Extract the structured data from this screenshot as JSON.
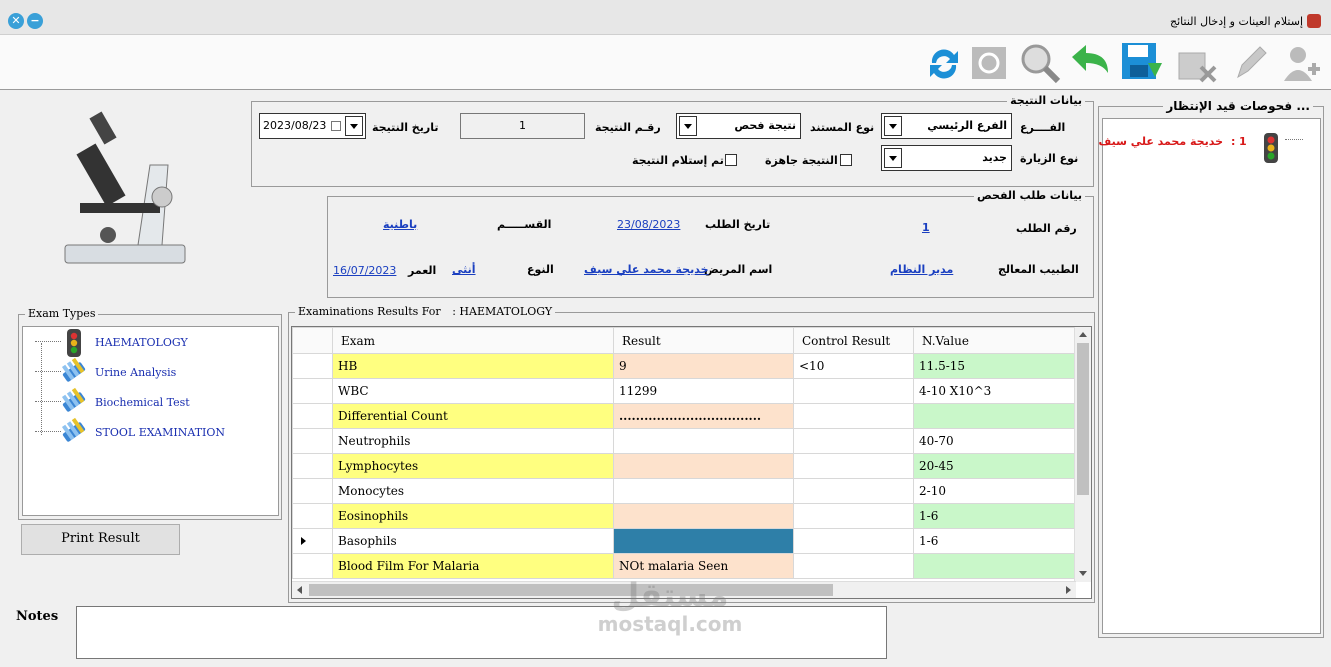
{
  "window": {
    "title": "إستلام العينات و إدخال النتائج",
    "controls": [
      "close",
      "minimize"
    ]
  },
  "toolbar": {
    "icons": [
      "add-user-icon",
      "edit-pencil-icon",
      "delete-icon",
      "save-icon",
      "undo-icon",
      "search-icon",
      "print-preview-icon",
      "refresh-icon"
    ]
  },
  "result_data": {
    "legend": "بيانات النتيجة",
    "branch_label": "الفــــرع",
    "branch_value": "الفرع الرئيسي",
    "doc_type_label": "نوع المستند",
    "doc_type_value": "نتيجة فحص",
    "result_no_label": "رقـم النتيجة",
    "result_no_value": "1",
    "result_date_label": "تاريخ النتيجة",
    "result_date_value": "2023/08/23",
    "visit_type_label": "نوع الزيارة",
    "visit_type_value": "جديد",
    "ready_label": "النتيجة جاهزة",
    "received_label": "تم إستلام النتيجة"
  },
  "request_data": {
    "legend": "بيانات طلب الفحص",
    "request_no_label": "رقم الطلب",
    "request_no_value": "1",
    "request_date_label": "تاريخ الطلب",
    "request_date_value": "23/08/2023",
    "department_label": "القســـــم",
    "department_value": "باطنية",
    "doctor_label": "الطبيب المعالج",
    "doctor_value": "مدير النظام",
    "patient_label": "اسم المريض",
    "patient_value": "خديجة محمد علي سيف",
    "gender_label": "النوع",
    "gender_value": "أنثى",
    "age_label": "العمر",
    "age_value": "16/07/2023"
  },
  "waiting": {
    "legend": "فحوصات قيد الإنتظار ...",
    "items": [
      {
        "number": "1",
        "separator": ":",
        "name": "خديجة محمد علي سيف"
      }
    ]
  },
  "exam_types": {
    "legend": "Exam Types",
    "items": [
      "HAEMATOLOGY",
      "Urine Analysis",
      "Biochemical Test",
      "STOOL EXAMINATION"
    ]
  },
  "results": {
    "legend": "Examinations Results For",
    "legend_sep": ":",
    "legend_value": "HAEMATOLOGY",
    "columns": [
      "Exam",
      "Result",
      "Control Result",
      "N.Value"
    ],
    "rows": [
      {
        "exam": "HB",
        "result": "9",
        "control": "<10",
        "nvalue": "11.5-15"
      },
      {
        "exam": "WBC",
        "result": "11299",
        "control": "",
        "nvalue": "4-10 X10^3"
      },
      {
        "exam": "Differential Count",
        "result": "..................................",
        "control": "",
        "nvalue": ""
      },
      {
        "exam": "Neutrophils",
        "result": "",
        "control": "",
        "nvalue": "40-70"
      },
      {
        "exam": "Lymphocytes",
        "result": "",
        "control": "",
        "nvalue": "20-45"
      },
      {
        "exam": "Monocytes",
        "result": "",
        "control": "",
        "nvalue": "2-10"
      },
      {
        "exam": "Eosinophils",
        "result": "",
        "control": "",
        "nvalue": "1-6"
      },
      {
        "exam": "Basophils",
        "result": "",
        "control": "",
        "nvalue": "1-6"
      },
      {
        "exam": "Blood Film For Malaria",
        "result": "NOt malaria Seen",
        "control": "",
        "nvalue": ""
      }
    ]
  },
  "print_button": "Print Result",
  "notes_label": "Notes",
  "notes_value": "",
  "watermark": {
    "arabic": "مستقل",
    "latin": "mostaql.com"
  },
  "colors": {
    "exam_yellow": "#ffff80",
    "result_peach": "#fde2cc",
    "nvalue_green": "#c9f7c9",
    "selected_blue": "#2e7fa8",
    "link_blue": "#1a3fc0",
    "waiting_red": "#d81818"
  }
}
